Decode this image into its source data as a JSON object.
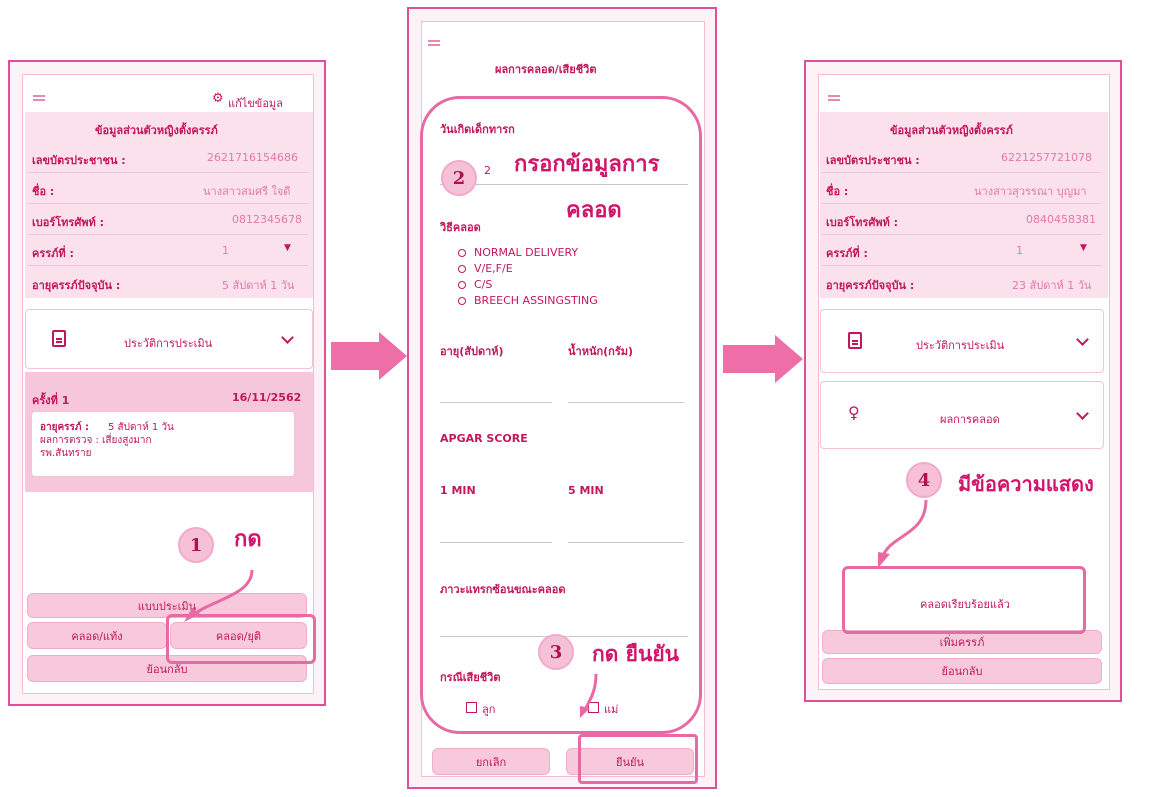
{
  "screen1": {
    "edit_label": "แก้ไขข้อมูล",
    "section_title": "ข้อมูลส่วนตัวหญิงตั้งครรภ์",
    "fields": [
      {
        "label": "เลขบัตรประชาชน :",
        "value": "2621716154686"
      },
      {
        "label": "ชื่อ :",
        "value": "นางสาวสมศรี ใจดี"
      },
      {
        "label": "เบอร์โทรศัพท์ :",
        "value": "0812345678"
      },
      {
        "label": "ครรภ์ที่ :",
        "value": "1"
      },
      {
        "label": "อายุครรภ์ปัจจุบัน :",
        "value": "5 สัปดาห์ 1 วัน"
      }
    ],
    "history_label": "ประวัติการประเมิน",
    "visit": {
      "label": "ครั้งที่ 1",
      "date": "16/11/2562",
      "age_label": "อายุครรภ์ :",
      "age_value": "5 สัปดาห์ 1 วัน",
      "result_label": "ผลการตรวจ :",
      "result_value": "เสี่ยงสูงมาก",
      "hospital": "รพ.สันทราย"
    },
    "buttons": {
      "assess": "แบบประเมิน",
      "abortion": "คลอด/แท้ง",
      "birth": "คลอด/ยุติ",
      "back": "ย้อนกลับ"
    }
  },
  "screen2": {
    "title": "ผลการคลอด/เสียชีวิต",
    "birthdate_label": "วันเกิดเด็กทารก",
    "birthdate_value": "2",
    "method_label": "วิธีคลอด",
    "methods": [
      "NORMAL DELIVERY",
      "V/E,F/E",
      "C/S",
      "BREECH ASSINGSTING"
    ],
    "age_label": "อายุ(สัปดาห์)",
    "weight_label": "น้ำหนัก(กรัม)",
    "apgar_label": "APGAR SCORE",
    "min1_label": "1 MIN",
    "min5_label": "5 MIN",
    "complication_label": "ภาวะแทรกซ้อนขณะคลอด",
    "death_label": "กรณีเสียชีวิต",
    "checkbox_child": "ลูก",
    "checkbox_mother": "แม่",
    "cancel": "ยกเลิก",
    "confirm": "ยืนยัน"
  },
  "screen3": {
    "section_title": "ข้อมูลส่วนตัวหญิงตั้งครรภ์",
    "fields": [
      {
        "label": "เลขบัตรประชาชน :",
        "value": "6221257721078"
      },
      {
        "label": "ชื่อ :",
        "value": "นางสาวสุวรรณา บุญมา"
      },
      {
        "label": "เบอร์โทรศัพท์ :",
        "value": "0840458381"
      },
      {
        "label": "ครรภ์ที่ :",
        "value": "1"
      },
      {
        "label": "อายุครรภ์ปัจจุบัน :",
        "value": "23 สัปดาห์ 1 วัน"
      }
    ],
    "history_label": "ประวัติการประเมิน",
    "birth_result_label": "ผลการคลอด",
    "message": "คลอดเรียบร้อยแล้ว",
    "add_pregnancy": "เพิ่มครรภ์",
    "back": "ย้อนกลับ"
  },
  "annotations": {
    "step1_num": "1",
    "step1_text": "กด",
    "step2_num": "2",
    "step2_text_line1": "กรอกข้อมูลการ",
    "step2_text_line2": "คลอด",
    "step3_num": "3",
    "step3_text": "กด ยืนยัน",
    "step4_num": "4",
    "step4_text": "มีข้อความแสดง"
  },
  "colors": {
    "accent": "#e04f97",
    "text": "#c2185b",
    "button": "#f7c9db",
    "annotation": "#d4136b"
  }
}
